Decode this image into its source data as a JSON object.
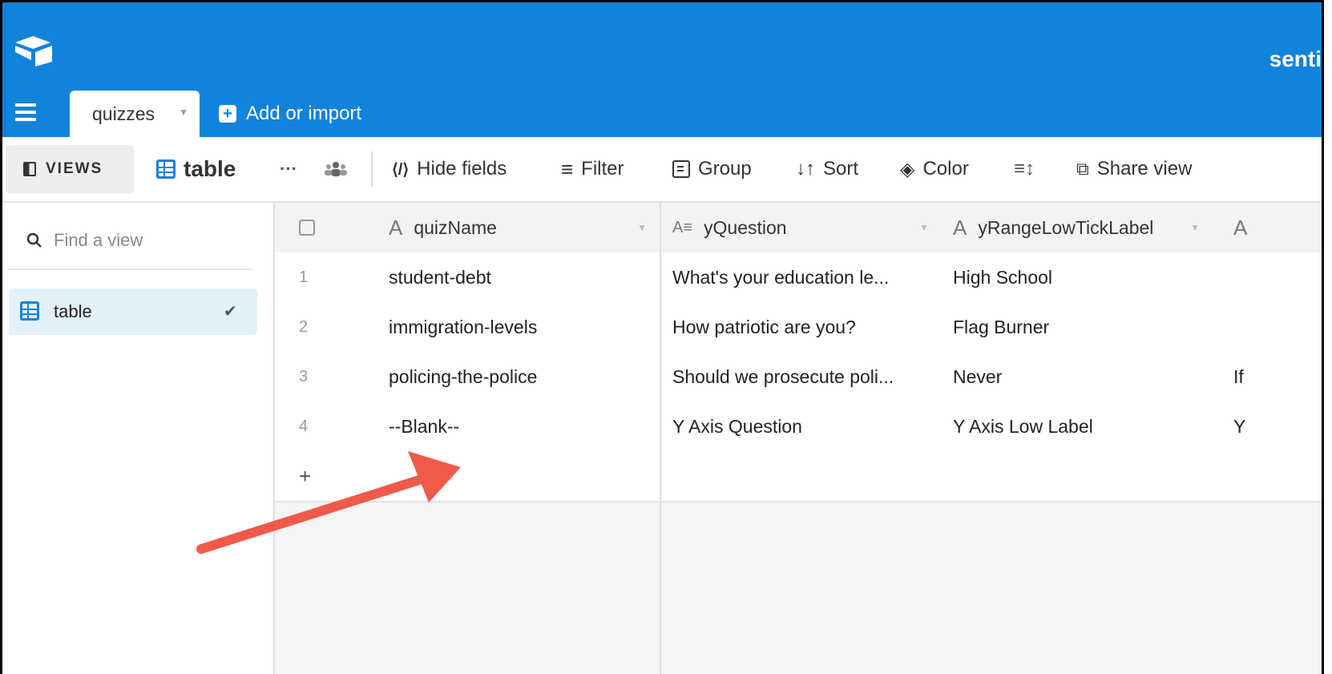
{
  "header": {
    "base_title": "senti",
    "active_tab": "quizzes",
    "add_import": "Add or import"
  },
  "toolbar": {
    "views": "VIEWS",
    "view_name": "table",
    "more": "···",
    "hide_fields": "Hide fields",
    "filter": "Filter",
    "group": "Group",
    "sort": "Sort",
    "color": "Color",
    "share_view": "Share view"
  },
  "sidebar": {
    "search_placeholder": "Find a view",
    "items": [
      {
        "label": "table",
        "selected": true
      }
    ]
  },
  "grid": {
    "columns": [
      "quizName",
      "yQuestion",
      "yRangeLowTickLabel",
      "A"
    ],
    "rows": [
      {
        "num": "1",
        "quizName": "student-debt",
        "yQuestion": "What's your education le...",
        "yRangeLowTickLabel": "High School",
        "next": ""
      },
      {
        "num": "2",
        "quizName": "immigration-levels",
        "yQuestion": "How patriotic are you?",
        "yRangeLowTickLabel": "Flag Burner",
        "next": ""
      },
      {
        "num": "3",
        "quizName": "policing-the-police",
        "yQuestion": "Should we prosecute poli...",
        "yRangeLowTickLabel": "Never",
        "next": "If"
      },
      {
        "num": "4",
        "quizName": "--Blank--",
        "yQuestion": "Y Axis Question",
        "yRangeLowTickLabel": "Y Axis Low Label",
        "next": "Y"
      }
    ],
    "add_row": "+"
  },
  "colors": {
    "brand_blue": "#1283da",
    "annotation_arrow": "#f05a4a"
  }
}
